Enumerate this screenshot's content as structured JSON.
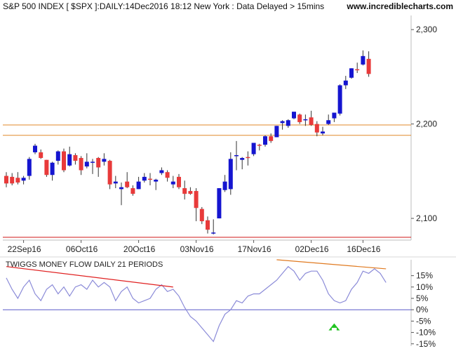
{
  "header": {
    "title": "S&P 500 INDEX [ $SPX ]:DAILY:14Dec2016 18:12 New York : Data Delayed > 15mins",
    "site": "www.incrediblecharts.com"
  },
  "colors": {
    "up": "#1515d0",
    "down": "#e83a3a",
    "resistance": "#e08a2a",
    "support": "#d01818",
    "indicator_line": "#8b8bd8",
    "zero_line": "#5a5ac8",
    "arrow": "#22c422",
    "trend_down": "#e02020",
    "trend_flat": "#e07a20",
    "frame": "#bcbcbc"
  },
  "chart_data": [
    {
      "type": "candlestick",
      "title": "S&P 500 INDEX [ $SPX ]:DAILY",
      "ylim": [
        2077,
        2315
      ],
      "yticks": [
        2100,
        2200,
        2300
      ],
      "ytick_labels": [
        "2,100",
        "2,200",
        "2,300"
      ],
      "xticks": [
        {
          "index": 3,
          "label": "22Sep16"
        },
        {
          "index": 13,
          "label": "06Oct16"
        },
        {
          "index": 23,
          "label": "20Oct16"
        },
        {
          "index": 33,
          "label": "03Nov16"
        },
        {
          "index": 43,
          "label": "17Nov16"
        },
        {
          "index": 53,
          "label": "02Dec16"
        },
        {
          "index": 62,
          "label": "16Dec16"
        }
      ],
      "horizontal_lines": [
        {
          "value": 2199,
          "color": "#e08a2a"
        },
        {
          "value": 2188,
          "color": "#e08a2a"
        },
        {
          "value": 2080,
          "color": "#d01818"
        }
      ],
      "series": [
        {
          "date": "15Sep16",
          "open": 2145,
          "high": 2149,
          "low": 2133,
          "close": 2137
        },
        {
          "date": "16Sep16",
          "open": 2144,
          "high": 2148,
          "low": 2135,
          "close": 2137
        },
        {
          "date": "19Sep16",
          "open": 2143,
          "high": 2149,
          "low": 2136,
          "close": 2138
        },
        {
          "date": "20Sep16",
          "open": 2140,
          "high": 2145,
          "low": 2136,
          "close": 2143
        },
        {
          "date": "21Sep16",
          "open": 2145,
          "high": 2165,
          "low": 2141,
          "close": 2163
        },
        {
          "date": "22Sep16",
          "open": 2170,
          "high": 2179,
          "low": 2168,
          "close": 2177
        },
        {
          "date": "23Sep16",
          "open": 2170,
          "high": 2173,
          "low": 2163,
          "close": 2164
        },
        {
          "date": "26Sep16",
          "open": 2162,
          "high": 2162,
          "low": 2144,
          "close": 2146
        },
        {
          "date": "27Sep16",
          "open": 2146,
          "high": 2160,
          "low": 2140,
          "close": 2159
        },
        {
          "date": "28Sep16",
          "open": 2161,
          "high": 2172,
          "low": 2157,
          "close": 2171
        },
        {
          "date": "29Sep16",
          "open": 2171,
          "high": 2174,
          "low": 2149,
          "close": 2151
        },
        {
          "date": "30Sep16",
          "open": 2156,
          "high": 2176,
          "low": 2155,
          "close": 2168
        },
        {
          "date": "03Oct16",
          "open": 2167,
          "high": 2169,
          "low": 2157,
          "close": 2161
        },
        {
          "date": "04Oct16",
          "open": 2164,
          "high": 2166,
          "low": 2146,
          "close": 2151
        },
        {
          "date": "05Oct16",
          "open": 2155,
          "high": 2169,
          "low": 2153,
          "close": 2160
        },
        {
          "date": "06Oct16",
          "open": 2159,
          "high": 2163,
          "low": 2147,
          "close": 2160
        },
        {
          "date": "07Oct16",
          "open": 2164,
          "high": 2165,
          "low": 2144,
          "close": 2154
        },
        {
          "date": "10Oct16",
          "open": 2160,
          "high": 2169,
          "low": 2156,
          "close": 2163
        },
        {
          "date": "11Oct16",
          "open": 2161,
          "high": 2162,
          "low": 2131,
          "close": 2136
        },
        {
          "date": "12Oct16",
          "open": 2137,
          "high": 2145,
          "low": 2132,
          "close": 2139
        },
        {
          "date": "13Oct16",
          "open": 2131,
          "high": 2138,
          "low": 2114,
          "close": 2133
        },
        {
          "date": "14Oct16",
          "open": 2139,
          "high": 2149,
          "low": 2132,
          "close": 2133
        },
        {
          "date": "17Oct16",
          "open": 2132,
          "high": 2135,
          "low": 2124,
          "close": 2126
        },
        {
          "date": "18Oct16",
          "open": 2131,
          "high": 2144,
          "low": 2131,
          "close": 2139
        },
        {
          "date": "19Oct16",
          "open": 2140,
          "high": 2148,
          "low": 2138,
          "close": 2144
        },
        {
          "date": "20Oct16",
          "open": 2142,
          "high": 2148,
          "low": 2135,
          "close": 2141
        },
        {
          "date": "21Oct16",
          "open": 2139,
          "high": 2142,
          "low": 2130,
          "close": 2141
        },
        {
          "date": "24Oct16",
          "open": 2148,
          "high": 2154,
          "low": 2146,
          "close": 2151
        },
        {
          "date": "25Oct16",
          "open": 2149,
          "high": 2151,
          "low": 2139,
          "close": 2143
        },
        {
          "date": "26Oct16",
          "open": 2136,
          "high": 2145,
          "low": 2132,
          "close": 2139
        },
        {
          "date": "27Oct16",
          "open": 2144,
          "high": 2147,
          "low": 2131,
          "close": 2133
        },
        {
          "date": "28Oct16",
          "open": 2132,
          "high": 2140,
          "low": 2120,
          "close": 2126
        },
        {
          "date": "31Oct16",
          "open": 2129,
          "high": 2133,
          "low": 2125,
          "close": 2126
        },
        {
          "date": "01Nov16",
          "open": 2129,
          "high": 2132,
          "low": 2097,
          "close": 2111
        },
        {
          "date": "02Nov16",
          "open": 2110,
          "high": 2112,
          "low": 2094,
          "close": 2097
        },
        {
          "date": "03Nov16",
          "open": 2098,
          "high": 2102,
          "low": 2084,
          "close": 2088
        },
        {
          "date": "04Nov16",
          "open": 2084,
          "high": 2099,
          "low": 2083,
          "close": 2085
        },
        {
          "date": "07Nov16",
          "open": 2100,
          "high": 2132,
          "low": 2100,
          "close": 2132
        },
        {
          "date": "08Nov16",
          "open": 2130,
          "high": 2146,
          "low": 2128,
          "close": 2139
        },
        {
          "date": "09Nov16",
          "open": 2131,
          "high": 2170,
          "low": 2125,
          "close": 2163
        },
        {
          "date": "10Nov16",
          "open": 2167,
          "high": 2182,
          "low": 2151,
          "close": 2167
        },
        {
          "date": "11Nov16",
          "open": 2162,
          "high": 2165,
          "low": 2152,
          "close": 2164
        },
        {
          "date": "14Nov16",
          "open": 2165,
          "high": 2171,
          "low": 2156,
          "close": 2164
        },
        {
          "date": "15Nov16",
          "open": 2168,
          "high": 2180,
          "low": 2166,
          "close": 2180
        },
        {
          "date": "16Nov16",
          "open": 2178,
          "high": 2179,
          "low": 2172,
          "close": 2177
        },
        {
          "date": "17Nov16",
          "open": 2178,
          "high": 2188,
          "low": 2176,
          "close": 2187
        },
        {
          "date": "18Nov16",
          "open": 2187,
          "high": 2190,
          "low": 2180,
          "close": 2182
        },
        {
          "date": "21Nov16",
          "open": 2186,
          "high": 2198,
          "low": 2186,
          "close": 2198
        },
        {
          "date": "22Nov16",
          "open": 2201,
          "high": 2204,
          "low": 2194,
          "close": 2203
        },
        {
          "date": "23Nov16",
          "open": 2198,
          "high": 2205,
          "low": 2196,
          "close": 2204
        },
        {
          "date": "25Nov16",
          "open": 2206,
          "high": 2213,
          "low": 2205,
          "close": 2213
        },
        {
          "date": "28Nov16",
          "open": 2210,
          "high": 2211,
          "low": 2200,
          "close": 2202
        },
        {
          "date": "29Nov16",
          "open": 2204,
          "high": 2210,
          "low": 2198,
          "close": 2205
        },
        {
          "date": "30Nov16",
          "open": 2207,
          "high": 2214,
          "low": 2198,
          "close": 2199
        },
        {
          "date": "01Dec16",
          "open": 2200,
          "high": 2203,
          "low": 2187,
          "close": 2191
        },
        {
          "date": "02Dec16",
          "open": 2190,
          "high": 2197,
          "low": 2188,
          "close": 2192
        },
        {
          "date": "05Dec16",
          "open": 2200,
          "high": 2210,
          "low": 2199,
          "close": 2204
        },
        {
          "date": "06Dec16",
          "open": 2206,
          "high": 2212,
          "low": 2202,
          "close": 2212
        },
        {
          "date": "07Dec16",
          "open": 2211,
          "high": 2242,
          "low": 2209,
          "close": 2241
        },
        {
          "date": "08Dec16",
          "open": 2241,
          "high": 2251,
          "low": 2237,
          "close": 2246
        },
        {
          "date": "09Dec16",
          "open": 2249,
          "high": 2259,
          "low": 2248,
          "close": 2259
        },
        {
          "date": "12Dec16",
          "open": 2258,
          "high": 2265,
          "low": 2254,
          "close": 2257
        },
        {
          "date": "13Dec16",
          "open": 2263,
          "high": 2278,
          "low": 2262,
          "close": 2272
        },
        {
          "date": "14Dec16",
          "open": 2269,
          "high": 2277,
          "low": 2250,
          "close": 2253
        }
      ]
    },
    {
      "type": "line",
      "title": "TWIGGS MONEY FLOW DAILY 21 PERIODS",
      "ylim": [
        -16,
        22
      ],
      "yticks": [
        -15,
        -10,
        -5,
        0,
        5,
        10,
        15
      ],
      "ytick_labels": [
        "-15%",
        "-10%",
        "-5%",
        "0%",
        "5%",
        "10%",
        "15%"
      ],
      "zero_line": 0,
      "values": [
        14,
        9,
        5,
        10,
        13,
        7,
        4,
        9,
        11,
        7,
        10,
        6,
        10,
        11,
        9,
        13,
        10,
        12,
        10,
        4,
        8,
        10,
        5,
        3,
        4,
        5,
        9,
        11,
        8,
        9,
        6,
        1,
        -3,
        -5,
        -8,
        -11,
        -14,
        -7,
        -2,
        0,
        4,
        3,
        6,
        7,
        7,
        9,
        11,
        13,
        16,
        19,
        17,
        13,
        16,
        17,
        17,
        13,
        7,
        4,
        3,
        4,
        9,
        12,
        17,
        16,
        18,
        16,
        12
      ],
      "trend_lines": [
        {
          "from": [
            0,
            19
          ],
          "to": [
            29,
            10
          ],
          "color": "#e02020"
        },
        {
          "from": [
            47,
            22
          ],
          "to": [
            66,
            18
          ],
          "color": "#e07a20"
        }
      ],
      "annotations": [
        {
          "type": "arrow-up",
          "index": 57,
          "value": -6,
          "color": "#22c422"
        }
      ]
    }
  ]
}
